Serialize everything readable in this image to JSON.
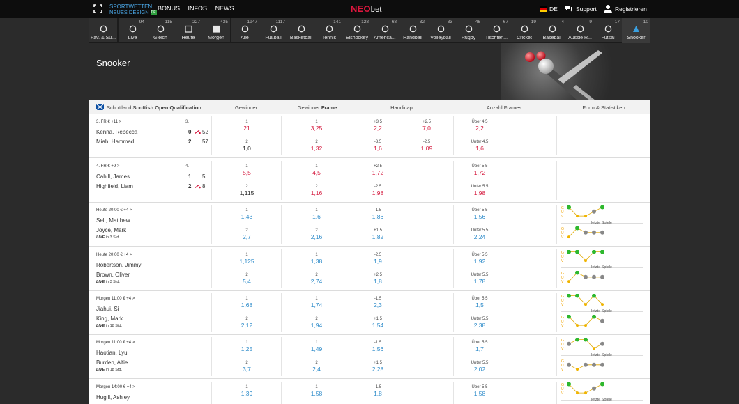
{
  "topbar": {
    "brand_line1": "SPORTWETTEN",
    "brand_line2": "NEUES DESIGN",
    "brand_badge": "DE",
    "nav": [
      "BONUS",
      "INFOS",
      "NEWS"
    ],
    "logo_main": "NEO",
    "logo_sub": "bet",
    "lang": "DE",
    "support": "Support",
    "register": "Registrieren"
  },
  "sports": [
    {
      "label": "Fav. & Su...",
      "count": "",
      "icon": "star-search-icon"
    },
    {
      "label": "Live",
      "count": "94",
      "icon": "live-signal-icon"
    },
    {
      "label": "Gleich",
      "count": "115",
      "icon": "clock-icon"
    },
    {
      "label": "Heute",
      "count": "227",
      "icon": "calendar-check-icon"
    },
    {
      "label": "Morgen",
      "count": "435",
      "icon": "calendar-day-icon"
    },
    {
      "label": "Alle",
      "count": "1947",
      "icon": "all-sports-icon"
    },
    {
      "label": "Fußball",
      "count": "1117",
      "icon": "football-icon"
    },
    {
      "label": "Basketball",
      "count": "",
      "icon": "basketball-icon"
    },
    {
      "label": "Tennis",
      "count": "141",
      "icon": "tennis-icon"
    },
    {
      "label": "Eishockey",
      "count": "128",
      "icon": "ice-hockey-icon"
    },
    {
      "label": "America...",
      "count": "68",
      "icon": "american-football-icon"
    },
    {
      "label": "Handball",
      "count": "32",
      "icon": "handball-icon"
    },
    {
      "label": "Volleyball",
      "count": "33",
      "icon": "volleyball-icon"
    },
    {
      "label": "Rugby",
      "count": "46",
      "icon": "rugby-icon"
    },
    {
      "label": "Tischten...",
      "count": "67",
      "icon": "table-tennis-icon"
    },
    {
      "label": "Cricket",
      "count": "19",
      "icon": "cricket-icon"
    },
    {
      "label": "Baseball",
      "count": "4",
      "icon": "baseball-icon"
    },
    {
      "label": "Aussie R...",
      "count": "9",
      "icon": "aussie-rules-icon"
    },
    {
      "label": "Futsal",
      "count": "17",
      "icon": "futsal-icon"
    },
    {
      "label": "Snooker",
      "count": "10",
      "icon": "snooker-icon"
    }
  ],
  "page_title": "Snooker",
  "table": {
    "league_country": "Schottland",
    "league_name": "Scottish Open Qualification",
    "headers": {
      "gewinner": "Gewinner",
      "gewinner_frame_a": "Gewinner",
      "gewinner_frame_b": "Frame",
      "handicap": "Handicap",
      "frames": "Anzahl Frames",
      "form": "Form & Statistiken"
    },
    "form_caption": "letzte Spiele",
    "form_letters": [
      "G",
      "U",
      "V"
    ],
    "matches": [
      {
        "meta": "3. FR € +11 >",
        "meta_right": "3.",
        "p1": "Kenna, Rebecca",
        "p2": "Miah, Hammad",
        "p1_frames": "0",
        "p1_points": "52",
        "p2_frames": "2",
        "p2_points": "57",
        "p1_serving": true,
        "p2_serving": false,
        "live_note": "",
        "live_tag": "",
        "w": [
          {
            "l": "1",
            "v": "21"
          },
          {
            "l": "2",
            "v": "1,0"
          }
        ],
        "wf": [
          {
            "l": "1",
            "v": "3,25"
          },
          {
            "l": "2",
            "v": "1,32"
          }
        ],
        "h1": [
          {
            "l": "+3.5",
            "v": "2,2"
          },
          {
            "l": "-3.5",
            "v": "1,6"
          }
        ],
        "h2": [
          {
            "l": "+2.5",
            "v": "7,0"
          },
          {
            "l": "-2.5",
            "v": "1,09"
          }
        ],
        "f": [
          {
            "l": "Über 4.5",
            "v": "2,2"
          },
          {
            "l": "Unter 4.5",
            "v": "1,6"
          }
        ],
        "style": "live",
        "form": null
      },
      {
        "meta": "4. FR € +9 >",
        "meta_right": "4.",
        "p1": "Cahill, James",
        "p2": "Highfield, Liam",
        "p1_frames": "1",
        "p1_points": "5",
        "p2_frames": "2",
        "p2_points": "8",
        "p1_serving": false,
        "p2_serving": true,
        "live_note": "",
        "live_tag": "",
        "w": [
          {
            "l": "1",
            "v": "5,5"
          },
          {
            "l": "2",
            "v": "1,115"
          }
        ],
        "wf": [
          {
            "l": "1",
            "v": "4,5"
          },
          {
            "l": "2",
            "v": "1,16"
          }
        ],
        "h1": [
          {
            "l": "+2.5",
            "v": "1,72"
          },
          {
            "l": "-2.5",
            "v": "1,98"
          }
        ],
        "h2": null,
        "f": [
          {
            "l": "Über 5.5",
            "v": "1,72"
          },
          {
            "l": "Unter 5.5",
            "v": "1,98"
          }
        ],
        "style": "live",
        "form": null
      },
      {
        "meta": "Heute 20:00 € +4 >",
        "meta_right": "",
        "p1": "Selt, Matthew",
        "p2": "Joyce, Mark",
        "p1_frames": "",
        "p1_points": "",
        "p2_frames": "",
        "p2_points": "",
        "p1_serving": false,
        "p2_serving": false,
        "live_tag": "LIVE",
        "live_note": "in 3 Std.",
        "w": [
          {
            "l": "1",
            "v": "1,43"
          },
          {
            "l": "2",
            "v": "2,7"
          }
        ],
        "wf": [
          {
            "l": "1",
            "v": "1,6"
          },
          {
            "l": "2",
            "v": "2,16"
          }
        ],
        "h1": [
          {
            "l": "-1.5",
            "v": "1,86"
          },
          {
            "l": "+1.5",
            "v": "1,82"
          }
        ],
        "h2": null,
        "f": [
          {
            "l": "Über 5.5",
            "v": "1,56"
          },
          {
            "l": "Unter 5.5",
            "v": "2,24"
          }
        ],
        "style": "pre",
        "form": {
          "top": [
            "G",
            "V",
            "V",
            "U",
            "G"
          ],
          "bottom": [
            "V",
            "G",
            "U",
            "U",
            "U"
          ]
        }
      },
      {
        "meta": "Heute 20:00 € +4 >",
        "meta_right": "",
        "p1": "Robertson, Jimmy",
        "p2": "Brown, Oliver",
        "p1_frames": "",
        "p1_points": "",
        "p2_frames": "",
        "p2_points": "",
        "p1_serving": false,
        "p2_serving": false,
        "live_tag": "LIVE",
        "live_note": "in 3 Std.",
        "w": [
          {
            "l": "1",
            "v": "1,125"
          },
          {
            "l": "2",
            "v": "5,4"
          }
        ],
        "wf": [
          {
            "l": "1",
            "v": "1,38"
          },
          {
            "l": "2",
            "v": "2,74"
          }
        ],
        "h1": [
          {
            "l": "-2.5",
            "v": "1,9"
          },
          {
            "l": "+2.5",
            "v": "1,8"
          }
        ],
        "h2": null,
        "f": [
          {
            "l": "Über 5.5",
            "v": "1,92"
          },
          {
            "l": "Unter 5.5",
            "v": "1,78"
          }
        ],
        "style": "pre",
        "form": {
          "top": [
            "G",
            "G",
            "V",
            "G",
            "G"
          ],
          "bottom": [
            "V",
            "G",
            "U",
            "U",
            "U"
          ]
        }
      },
      {
        "meta": "Morgen 11:00 € +4 >",
        "meta_right": "",
        "p1": "Jiahui, Si",
        "p2": "King, Mark",
        "p1_frames": "",
        "p1_points": "",
        "p2_frames": "",
        "p2_points": "",
        "p1_serving": false,
        "p2_serving": false,
        "live_tag": "LIVE",
        "live_note": "in 18 Std.",
        "w": [
          {
            "l": "1",
            "v": "1,68"
          },
          {
            "l": "2",
            "v": "2,12"
          }
        ],
        "wf": [
          {
            "l": "1",
            "v": "1,74"
          },
          {
            "l": "2",
            "v": "1,94"
          }
        ],
        "h1": [
          {
            "l": "-1.5",
            "v": "2,3"
          },
          {
            "l": "+1.5",
            "v": "1,54"
          }
        ],
        "h2": null,
        "f": [
          {
            "l": "Über 5.5",
            "v": "1,5"
          },
          {
            "l": "Unter 5.5",
            "v": "2,38"
          }
        ],
        "style": "pre",
        "form": {
          "top": [
            "G",
            "G",
            "V",
            "G",
            "V"
          ],
          "bottom": [
            "G",
            "V",
            "V",
            "G",
            "U"
          ]
        }
      },
      {
        "meta": "Morgen 11:00 € +4 >",
        "meta_right": "",
        "p1": "Haotian, Lyu",
        "p2": "Burden, Alfie",
        "p1_frames": "",
        "p1_points": "",
        "p2_frames": "",
        "p2_points": "",
        "p1_serving": false,
        "p2_serving": false,
        "live_tag": "LIVE",
        "live_note": "in 18 Std.",
        "w": [
          {
            "l": "1",
            "v": "1,25"
          },
          {
            "l": "2",
            "v": "3,7"
          }
        ],
        "wf": [
          {
            "l": "1",
            "v": "1,49"
          },
          {
            "l": "2",
            "v": "2,4"
          }
        ],
        "h1": [
          {
            "l": "-1.5",
            "v": "1,56"
          },
          {
            "l": "+1.5",
            "v": "2,28"
          }
        ],
        "h2": null,
        "f": [
          {
            "l": "Über 5.5",
            "v": "1,7"
          },
          {
            "l": "Unter 5.5",
            "v": "2,02"
          }
        ],
        "style": "pre",
        "form": {
          "top": [
            "U",
            "G",
            "G",
            "V",
            "U"
          ],
          "bottom": [
            "U",
            "V",
            "U",
            "U",
            "U"
          ]
        }
      },
      {
        "meta": "Morgen 14:00 € +4 >",
        "meta_right": "",
        "p1": "Hugill, Ashley",
        "p2": "",
        "p1_frames": "",
        "p1_points": "",
        "p2_frames": "",
        "p2_points": "",
        "p1_serving": false,
        "p2_serving": false,
        "live_tag": "",
        "live_note": "",
        "w": [
          {
            "l": "1",
            "v": "1,39"
          }
        ],
        "wf": [
          {
            "l": "1",
            "v": "1,58"
          }
        ],
        "h1": [
          {
            "l": "-1.5",
            "v": "1,8"
          }
        ],
        "h2": null,
        "f": [
          {
            "l": "Über 5.5",
            "v": "1,58"
          }
        ],
        "style": "pre",
        "form": {
          "top": [
            "G",
            "V",
            "V",
            "U",
            "G"
          ],
          "bottom": []
        }
      }
    ]
  },
  "colors": {
    "odd_red": "#d4153a",
    "odd_blue": "#2b8ac9",
    "form_win": "#2eb82e",
    "form_loss": "#f0b400",
    "form_draw": "#888888"
  }
}
